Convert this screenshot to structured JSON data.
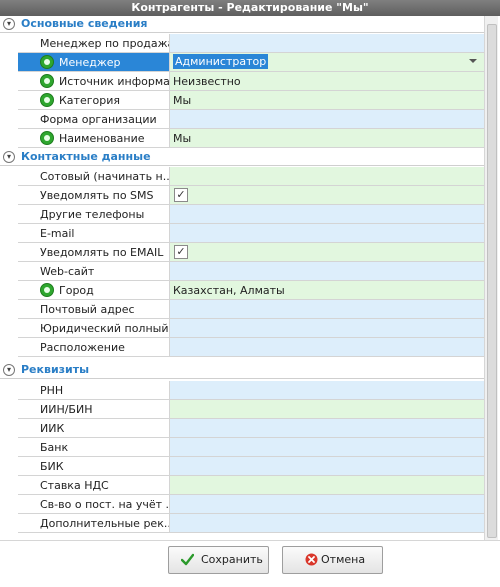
{
  "window": {
    "title": "Контрагенты - Редактирование \"Мы\""
  },
  "groups": {
    "basic": {
      "label": "Основные сведения",
      "rows": [
        {
          "name": "Менеджер по продажам",
          "value": "",
          "required": false,
          "valueColor": "blue"
        },
        {
          "name": "Менеджер",
          "value": "Администратор",
          "required": true,
          "valueColor": "green",
          "selected": true,
          "control": "dropdown"
        },
        {
          "name": "Источник информа...",
          "value": "Неизвестно",
          "required": true,
          "valueColor": "green"
        },
        {
          "name": "Категория",
          "value": "Мы",
          "required": true,
          "valueColor": "green"
        },
        {
          "name": "Форма организации",
          "value": "",
          "required": false,
          "valueColor": "blue"
        },
        {
          "name": "Наименование",
          "value": "Мы",
          "required": true,
          "valueColor": "green"
        }
      ]
    },
    "contacts": {
      "label": "Контактные данные",
      "rows": [
        {
          "name": "Сотовый (начинать н...",
          "value": "",
          "required": false,
          "valueColor": "green"
        },
        {
          "name": "Уведомлять по SMS",
          "value": "",
          "checked": true,
          "required": false,
          "valueColor": "green"
        },
        {
          "name": "Другие телефоны",
          "value": "",
          "required": false,
          "valueColor": "blue"
        },
        {
          "name": "E-mail",
          "value": "",
          "required": false,
          "valueColor": "blue"
        },
        {
          "name": "Уведомлять по EMAIL",
          "value": "",
          "checked": true,
          "required": false,
          "valueColor": "green"
        },
        {
          "name": "Web-сайт",
          "value": "",
          "required": false,
          "valueColor": "blue"
        },
        {
          "name": "Город",
          "value": "Казахстан, Алматы",
          "required": true,
          "valueColor": "green"
        },
        {
          "name": "Почтовый адрес",
          "value": "",
          "required": false,
          "valueColor": "blue"
        },
        {
          "name": "Юридический полный...",
          "value": "",
          "required": false,
          "valueColor": "blue"
        },
        {
          "name": "Расположение",
          "value": "",
          "required": false,
          "valueColor": "blue"
        }
      ]
    },
    "requisites": {
      "label": "Реквизиты",
      "rows": [
        {
          "name": "РНН",
          "value": "",
          "required": false,
          "valueColor": "blue"
        },
        {
          "name": "ИИН/БИН",
          "value": "",
          "required": false,
          "valueColor": "green"
        },
        {
          "name": "ИИК",
          "value": "",
          "required": false,
          "valueColor": "blue"
        },
        {
          "name": "Банк",
          "value": "",
          "required": false,
          "valueColor": "blue"
        },
        {
          "name": "БИК",
          "value": "",
          "required": false,
          "valueColor": "blue"
        },
        {
          "name": "Ставка НДС",
          "value": "",
          "required": false,
          "valueColor": "green"
        },
        {
          "name": "Св-во о пост. на учёт ...",
          "value": "",
          "required": false,
          "valueColor": "blue"
        },
        {
          "name": "Дополнительные рек...",
          "value": "",
          "required": false,
          "valueColor": "blue"
        }
      ]
    }
  },
  "buttons": {
    "save_label": "Сохранить",
    "cancel_label": "Отмена"
  },
  "colors": {
    "accent": "#2a7ec6",
    "selection": "#2a86d7",
    "value_blue": "#ddeefb",
    "value_green": "#e2f7df",
    "required_icon": "#2fa72f",
    "cancel_icon": "#d9372b"
  }
}
